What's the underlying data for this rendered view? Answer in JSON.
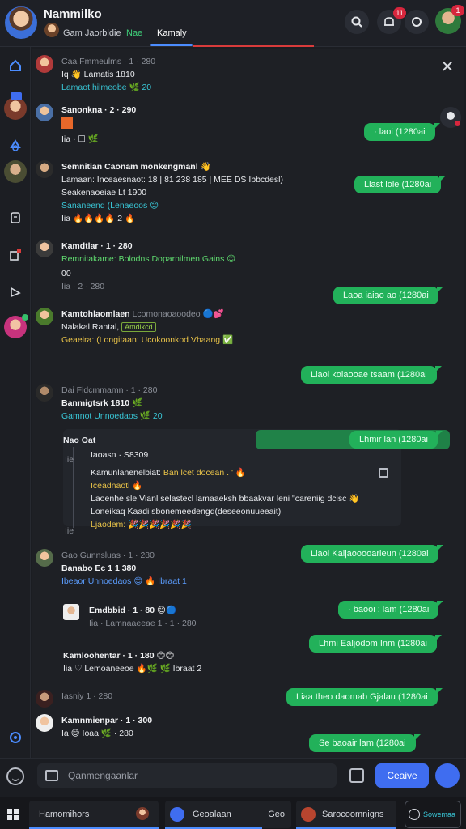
{
  "header": {
    "app_title": "Nammilko",
    "tabs": [
      {
        "label": "Gam Jaorbldie"
      },
      {
        "label": "Nae"
      },
      {
        "label": "Kamaly"
      }
    ],
    "notification_badge": "11",
    "profile_badge": "1"
  },
  "messages": {
    "m1": {
      "meta": "Caa Fmmeulms · 1 · 280",
      "text": "Iq 👋 Lamatis 1810",
      "reaction": "Lamaot hilmeobe 🌿 20"
    },
    "m2": {
      "name": "Sanonkna · 2 · 290",
      "text": "Iia · ☐ 🌿"
    },
    "m3": {
      "name": "Semnitian Caonam monkengmanl 👋",
      "line2": "Lamaan: Inceaesnaot: 18 | 81 238 185 | MEE DS Ibbcdesl)",
      "line3": "Seakenaoeiae Lt 1900",
      "line4": "Sananeend (Lenaeoos 😊",
      "line5": "Iia 🔥🔥🔥🔥 2 🔥"
    },
    "m4": {
      "name": "Kamdtlar · 1 · 280",
      "text": "Remnitakame: Bolodns Doparnilmen Gains 😊",
      "line3": "00",
      "line4": "Iia · 2 · 280"
    },
    "m5": {
      "name": "Kamtohlaomlaen",
      "name_extra": "Lcomonaoaoodeo 🔵💕",
      "line2": "Nalakal Rantal,",
      "line2_badge": "Amdikcd",
      "line3": "Geaelra: (Longitaan: Ucokoonkod Vhaang ✅"
    },
    "m6": {
      "meta": "Dai Fldcmmamn · 1 · 280",
      "name": "Banmigtsrk 1810 🌿",
      "text": "Gamnot Unnoedaos 🌿 20"
    },
    "m7": {
      "header": "Nao Oat",
      "line1": "Iaoasn · S8309",
      "name": "Kamunlanenelbiat: ",
      "name_extra": "Ban lcet docean . ' 🔥",
      "line3": "Iceadnaoti 🔥",
      "line4": "Laoenhe sle Vianl selastecl lamaaeksh bbaakvar leni \"careniig dcisc 👋",
      "line5": "Loneikaq Kaadi sbonemeedengd(deseeonuueeait)",
      "line6": "Ljaodem: 🎉🎉🎉🎉🎉🎉",
      "dim1": "Iie",
      "dim2": "Iie"
    },
    "m8": {
      "meta": "Gao Gunnsluas · 1 · 280",
      "name": "Banabo Ec 1 1 380",
      "text": "Ibeaor Unnoedaos 😊 🔥 Ibraat 1"
    },
    "m9": {
      "name": "Emdbbid · 1 · 80 😊🔵",
      "text": "Iia · Lamnaaeeae 1 · 1 · 280"
    },
    "m10": {
      "name": "Kamloohentar · 1 · 180 😊😊",
      "text": "Iia ♡ Lemoaneeoe 🔥🌿 🌿 Ibraat 2"
    },
    "m11": {
      "name": "Iasniy 1 · 280"
    },
    "m12": {
      "name": "Kamnmienpar · 1 · 300",
      "text": "Ia 😊 Ioaa 🌿 · 280"
    }
  },
  "outgoing": [
    {
      "text": "· laoi (1280ai"
    },
    {
      "text": "Llast lole (1280ai"
    },
    {
      "text": "Laoa iaiao ao (1280ai"
    },
    {
      "text": "Liaoi kolaooae tsaam (1280ai"
    },
    {
      "text": "Lhmir lan (1280ai"
    },
    {
      "text": "Liaoi Kaljaooooarieun (1280ai"
    },
    {
      "text": "· baooi : lam (1280ai"
    },
    {
      "text": "Lhmi Ealjodom Inm (1280ai"
    },
    {
      "text": "Liaa theo daomab Gjalau (1280ai"
    },
    {
      "text": "Se baoair lam (1280ai"
    }
  ],
  "composer": {
    "placeholder": "Qanmengaanlar",
    "send_label": "Ceaive"
  },
  "taskbar": {
    "items": [
      {
        "label": "Hamomihors"
      },
      {
        "label": "Geoalaan"
      },
      {
        "label": "Geo"
      },
      {
        "label": "Sarocoomnigns"
      },
      {
        "label": "Sowemaa"
      }
    ]
  },
  "colors": {
    "accent_blue": "#3f6df0",
    "outgoing_green": "#22b15a",
    "badge_red": "#d7263d"
  },
  "icons": [
    "home-icon",
    "chat-icon",
    "contacts-icon",
    "notes-icon",
    "apps-icon",
    "comment-icon",
    "search-icon",
    "bell-icon",
    "refresh-icon",
    "close-icon",
    "emoji-icon",
    "gallery-icon",
    "attach-icon",
    "mic-icon",
    "grid-icon"
  ]
}
